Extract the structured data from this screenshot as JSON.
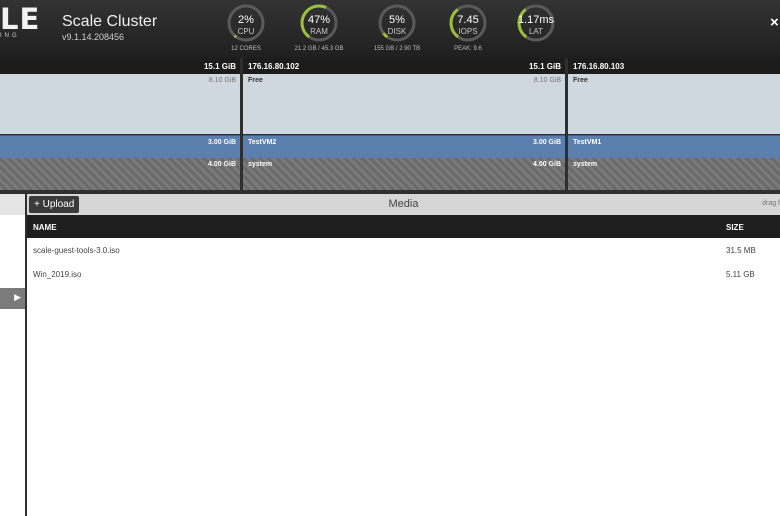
{
  "header": {
    "logo_text": "LE",
    "logo_sub": "ING",
    "cluster_name": "Scale Cluster",
    "version": "v9.1.14.208456",
    "close_glyph": "×"
  },
  "gauges": [
    {
      "value": "2%",
      "label": "CPU",
      "sub": "12 CORES",
      "fraction": 0.02,
      "color": "#9cbf3a"
    },
    {
      "value": "47%",
      "label": "RAM",
      "sub": "21.2 GB / 45.3 GB",
      "fraction": 0.47,
      "color": "#9cbf3a"
    },
    {
      "value": "5%",
      "label": "DISK",
      "sub": "155 GB / 2.90 TB",
      "fraction": 0.05,
      "color": "#9cbf3a"
    },
    {
      "value": "7.45",
      "label": "IOPS",
      "sub": "PEAK: 9.6",
      "fraction": 0.3,
      "color": "#9cbf3a"
    },
    {
      "value": "1.17ms",
      "label": "LAT",
      "sub": "",
      "fraction": 0.3,
      "color": "#9cbf3a"
    }
  ],
  "nodes": [
    {
      "ip": "",
      "capacity": "15.1 GiB",
      "free_label": "",
      "free_size": "8.10 GiB",
      "vm_label": "",
      "vm_size": "3.00 GiB",
      "sys_label": "",
      "sys_size": "4.00 GiB"
    },
    {
      "ip": "176.16.80.102",
      "capacity": "15.1 GiB",
      "free_label": "Free",
      "free_size": "8.10 GiB",
      "vm_label": "TestVM2",
      "vm_size": "3.00 GiB",
      "sys_label": "system",
      "sys_size": "4.00 GiB"
    },
    {
      "ip": "176.16.80.103",
      "capacity": "",
      "free_label": "Free",
      "free_size": "",
      "vm_label": "TestVM1",
      "vm_size": "",
      "sys_label": "system",
      "sys_size": ""
    }
  ],
  "left_panel": {
    "arrow_glyph": "▶"
  },
  "media": {
    "upload_label": "+ Upload",
    "title": "Media",
    "drag_hint": "drag f",
    "columns": {
      "name": "NAME",
      "size": "SIZE"
    },
    "rows": [
      {
        "name": "scale-guest-tools-3.0.iso",
        "size": "31.5 MB"
      },
      {
        "name": "Win_2019.iso",
        "size": "5.11 GB"
      }
    ]
  }
}
